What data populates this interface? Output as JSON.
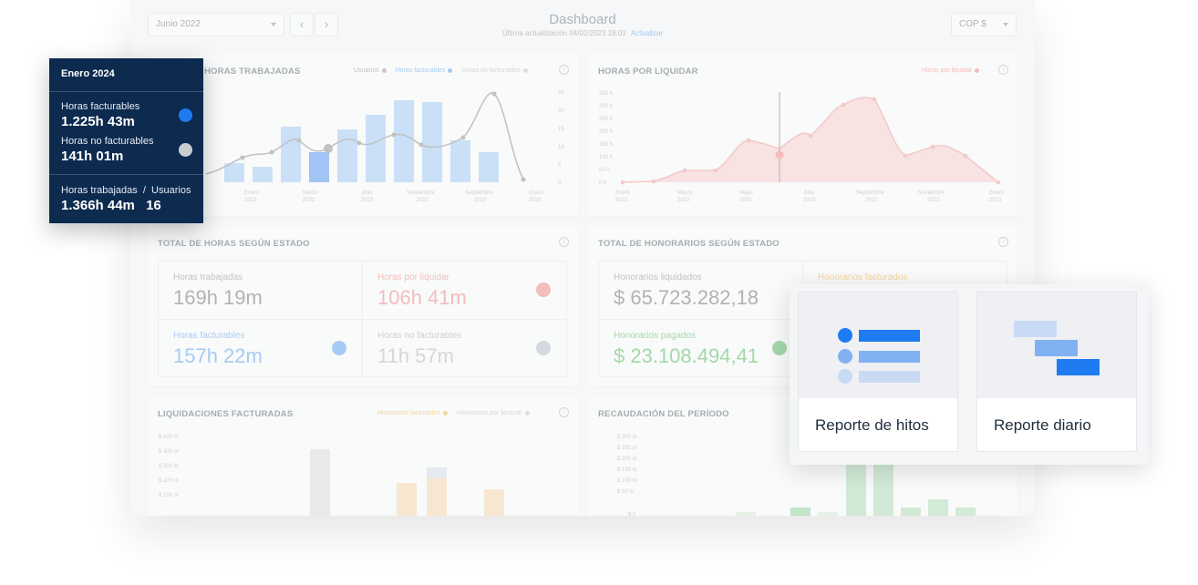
{
  "dashboard": {
    "title": "Dashboard",
    "subtitle": "Última actualización 04/01/2023 18:03",
    "refresh_label": "Actualizar",
    "period_select": "Junio 2022",
    "currency_select": "COP $",
    "prev_icon": "chevron-left-icon",
    "next_icon": "chevron-right-icon"
  },
  "cards": {
    "hours_worked": {
      "title": "HORAS TRABAJADAS",
      "legend": [
        "Usuarios",
        "Horas facturables",
        "Horas no facturables"
      ],
      "x_labels": [
        [
          "Enero",
          "2022"
        ],
        [
          "Marzo",
          "2022"
        ],
        [
          "Julio",
          "2022"
        ],
        [
          "Septiembre",
          "2022"
        ],
        [
          "Septiembre",
          "2022"
        ],
        [
          "Enero",
          "2023"
        ]
      ],
      "y_labels": [
        "25",
        "20",
        "15",
        "10",
        "5",
        "0"
      ]
    },
    "hours_to_settle": {
      "title": "HORAS POR LIQUIDAR",
      "legend": [
        "Horas por liquidar"
      ],
      "y_labels": [
        "350 h",
        "300 h",
        "250 h",
        "200 h",
        "150 h",
        "100 h",
        "50 h",
        "0 h"
      ],
      "x_labels": [
        [
          "Enero",
          "2022"
        ],
        [
          "Marzo",
          "2022"
        ],
        [
          "Mayo",
          "2022"
        ],
        [
          "Julio",
          "2022"
        ],
        [
          "Septiembre",
          "2022"
        ],
        [
          "Noviembre",
          "2022"
        ],
        [
          "Enero",
          "2023"
        ]
      ]
    },
    "hours_by_status": {
      "title": "TOTAL DE HORAS SEGÚN ESTADO",
      "stats": [
        {
          "label": "Horas trabajadas",
          "value": "169h 19m"
        },
        {
          "label": "Horas por liquidar",
          "value": "106h 41m"
        },
        {
          "label": "Horas facturables",
          "value": "157h 22m"
        },
        {
          "label": "Horas no facturables",
          "value": "11h 57m"
        }
      ]
    },
    "fees_by_status": {
      "title": "TOTAL DE HONORARIOS SEGÚN ESTADO",
      "stats": [
        {
          "label": "Honorarios liquidados",
          "value": "$ 65.723.282,18"
        },
        {
          "label": "Honorarios facturados",
          "value": ""
        },
        {
          "label": "Honorarios pagados",
          "value": "$ 23.108.494,41"
        }
      ]
    },
    "invoiced_settlements": {
      "title": "LIQUIDACIONES FACTURADAS",
      "legend": [
        "Honorarios facturados",
        "Honorarios por facturar"
      ],
      "y_labels": [
        "$ 500 m",
        "$ 400 m",
        "$ 300 m",
        "$ 200 m",
        "$ 100 m"
      ]
    },
    "period_collection": {
      "title": "RECAUDACIÓN DEL PERÍODO",
      "y_labels": [
        "$ 300 m",
        "$ 250 m",
        "$ 200 m",
        "$ 150 m",
        "$ 100 m",
        "$ 50 m",
        "$ 0"
      ]
    }
  },
  "tooltip": {
    "title": "Enero 2024",
    "billable_label": "Horas facturables",
    "billable_value": "1.225h 43m",
    "nonbillable_label": "Horas no facturables",
    "nonbillable_value": "141h 01m",
    "worked_users_label": "Horas trabajadas  /  Usuarios",
    "worked_value": "1.366h 44m",
    "users_value": "16",
    "colors": {
      "billable": "#1e7bf2",
      "nonbillable": "#c9ccd2"
    }
  },
  "reports": {
    "milestones_label": "Reporte de hitos",
    "daily_label": "Reporte diario",
    "accent": "#1e7bf2"
  }
}
